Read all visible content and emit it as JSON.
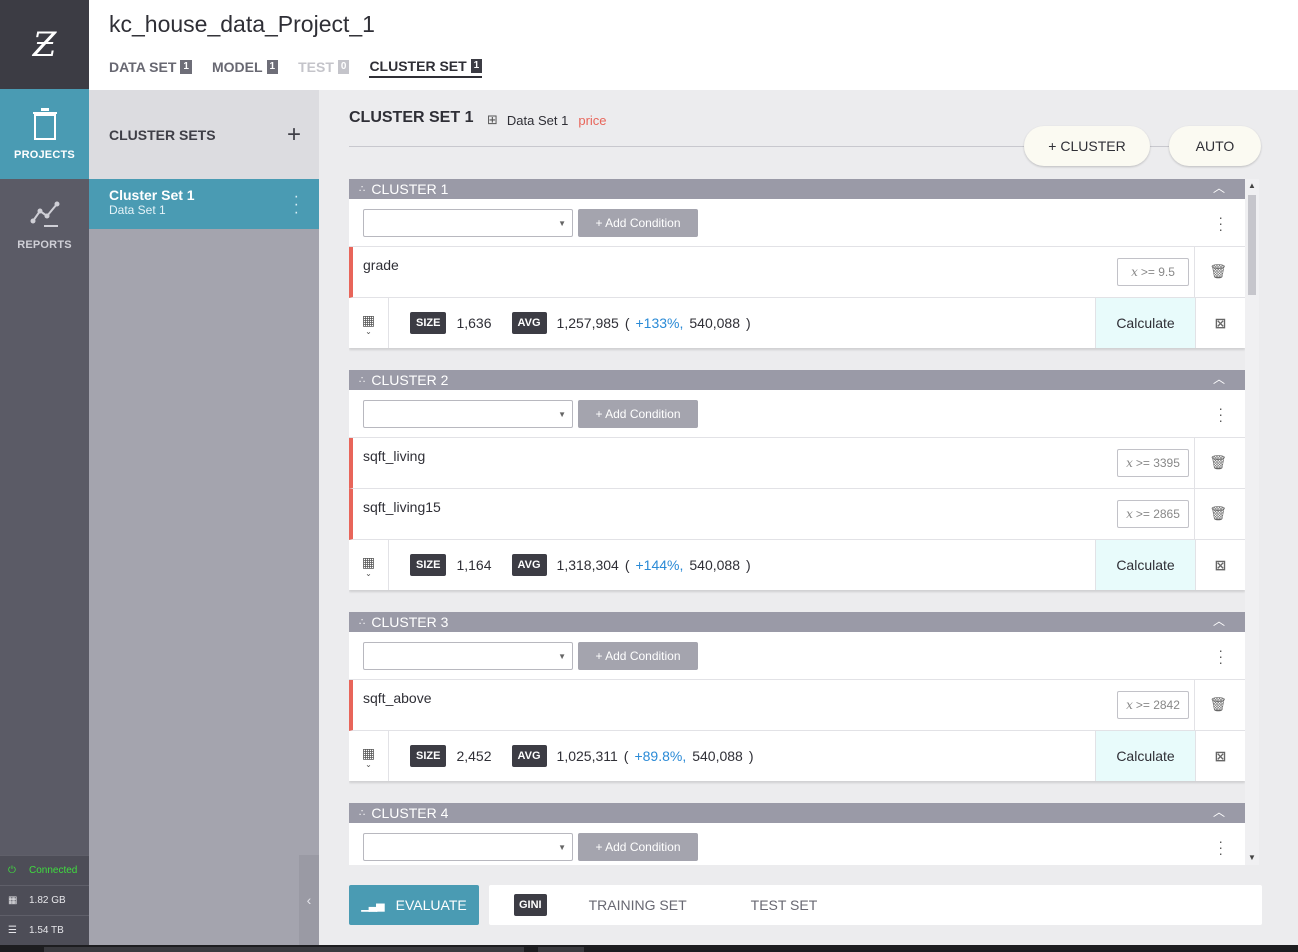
{
  "app": {
    "logo": "Ƶ",
    "nav": [
      {
        "label": "PROJECTS",
        "icon": "trash-can-icon"
      },
      {
        "label": "REPORTS",
        "icon": "line-chart-icon"
      }
    ],
    "status": {
      "connection": "Connected",
      "memory": "1.82 GB",
      "disk": "1.54 TB"
    }
  },
  "header": {
    "title": "kc_house_data_Project_1",
    "tabs": [
      {
        "label": "DATA SET",
        "count": "1"
      },
      {
        "label": "MODEL",
        "count": "1"
      },
      {
        "label": "TEST",
        "count": "0"
      },
      {
        "label": "CLUSTER SET",
        "count": "1"
      }
    ]
  },
  "sidebar": {
    "title": "CLUSTER SETS",
    "add": "+",
    "items": [
      {
        "name": "Cluster Set 1",
        "subtitle": "Data Set 1"
      }
    ]
  },
  "main": {
    "title": "CLUSTER SET 1",
    "dataset": "Data Set 1",
    "target": "price",
    "add_cluster": "+ CLUSTER",
    "auto": "AUTO",
    "add_condition": "+ Add Condition",
    "calculate": "Calculate",
    "size_label": "SIZE",
    "avg_label": "AVG",
    "range_var": "x",
    "clusters": [
      {
        "title": "CLUSTER 1",
        "conditions": [
          {
            "var": "grade",
            "range": ">= 9.5"
          }
        ],
        "size": "1,636",
        "avg": "1,257,985",
        "pct": "+133%,",
        "base": "540,088"
      },
      {
        "title": "CLUSTER 2",
        "conditions": [
          {
            "var": "sqft_living",
            "range": ">= 3395"
          },
          {
            "var": "sqft_living15",
            "range": ">= 2865"
          }
        ],
        "size": "1,164",
        "avg": "1,318,304",
        "pct": "+144%,",
        "base": "540,088"
      },
      {
        "title": "CLUSTER 3",
        "conditions": [
          {
            "var": "sqft_above",
            "range": ">= 2842"
          }
        ],
        "size": "2,452",
        "avg": "1,025,311",
        "pct": "+89.8%,",
        "base": "540,088"
      },
      {
        "title": "CLUSTER 4",
        "conditions": []
      }
    ]
  },
  "evaluate": {
    "button": "EVALUATE",
    "metric": "GINI",
    "options": [
      "TRAINING SET",
      "TEST SET"
    ]
  },
  "colors": {
    "accent": "#4a9bb3",
    "condition_marker": "#e8655a",
    "pct_positive": "#2a8ad6",
    "calculate_bg": "#e8fbfb"
  }
}
